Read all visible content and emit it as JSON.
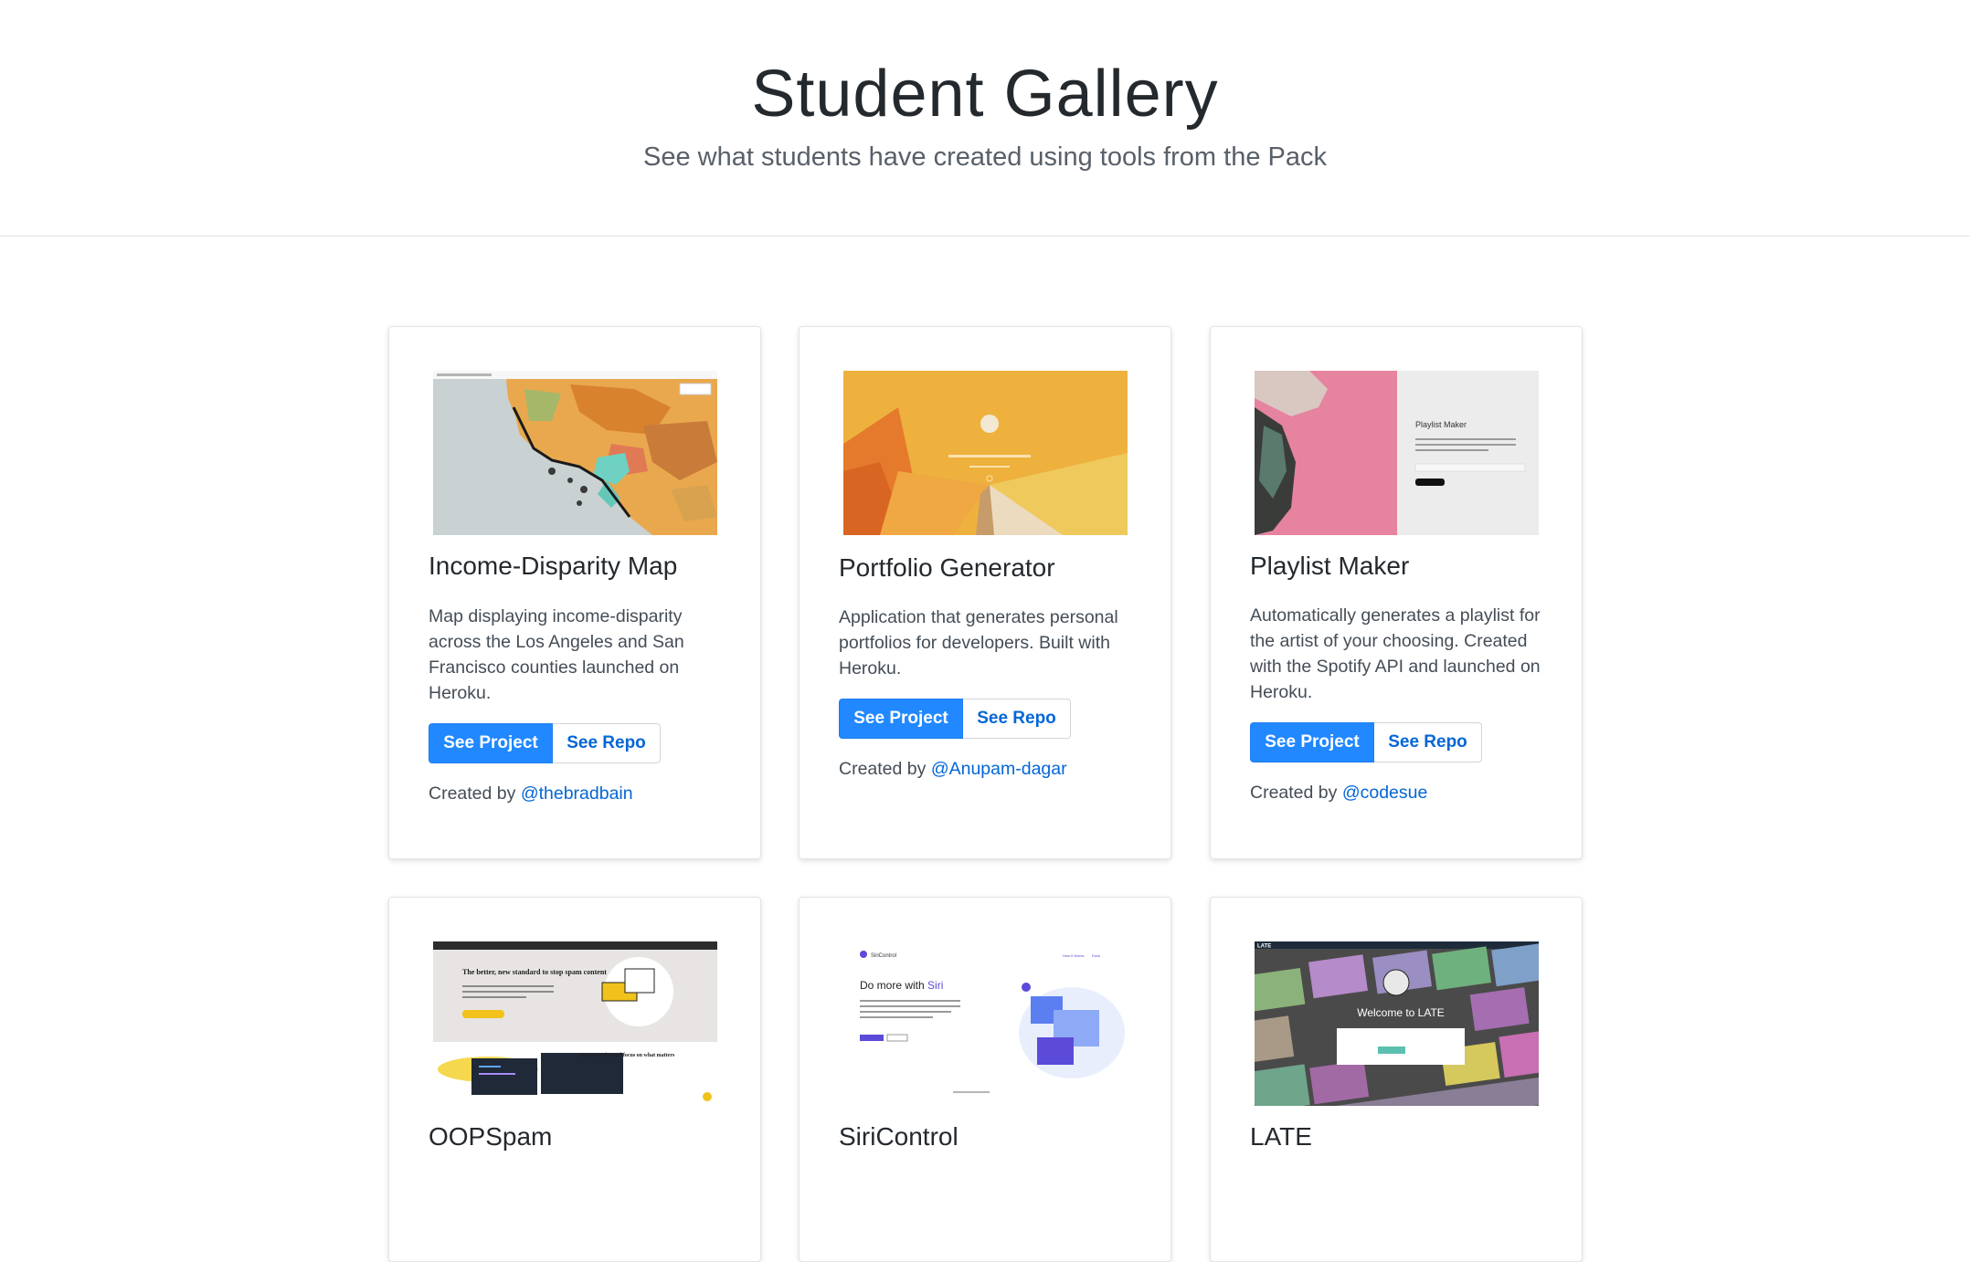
{
  "header": {
    "title": "Student Gallery",
    "subtitle": "See what students have created using tools from the Pack"
  },
  "projects": [
    {
      "title": "Income-Disparity Map",
      "description": "Map displaying income-disparity across the Los Angeles and San Francisco counties launched on Heroku.",
      "project_label": "See Project",
      "repo_label": "See Repo",
      "credit_prefix": "Created by",
      "author": "@thebradbain"
    },
    {
      "title": "Portfolio Generator",
      "description": "Application that generates personal portfolios for developers. Built with Heroku.",
      "project_label": "See Project",
      "repo_label": "See Repo",
      "credit_prefix": "Created by",
      "author": "@Anupam-dagar"
    },
    {
      "title": "Playlist Maker",
      "description": "Automatically generates a playlist for the artist of your choosing. Created with the Spotify API and launched on Heroku.",
      "project_label": "See Project",
      "repo_label": "See Repo",
      "credit_prefix": "Created by",
      "author": "@codesue"
    },
    {
      "title": "OOPSpam"
    },
    {
      "title": "SiriControl"
    },
    {
      "title": "LATE"
    }
  ],
  "thumbnails": {
    "oopspam_headline": "The better, new standard to stop spam content",
    "oopspam_cta": "Get started now",
    "oopspam_feature_title": "Remove noise and focus on what matters",
    "siricontrol_brand": "SiriControl",
    "siricontrol_headline_prefix": "Do more with",
    "siricontrol_headline_accent": "Siri",
    "siricontrol_nav_1": "How it Works",
    "siricontrol_nav_2": "Docs",
    "late_brand": "LATE",
    "late_welcome": "Welcome to LATE",
    "playlist_title": "Playlist Maker"
  },
  "colors": {
    "primary_button": "#2188ff",
    "link": "#0366d6",
    "portfolio_bg": "#eeb13e",
    "playlist_pink": "#e6839f"
  }
}
